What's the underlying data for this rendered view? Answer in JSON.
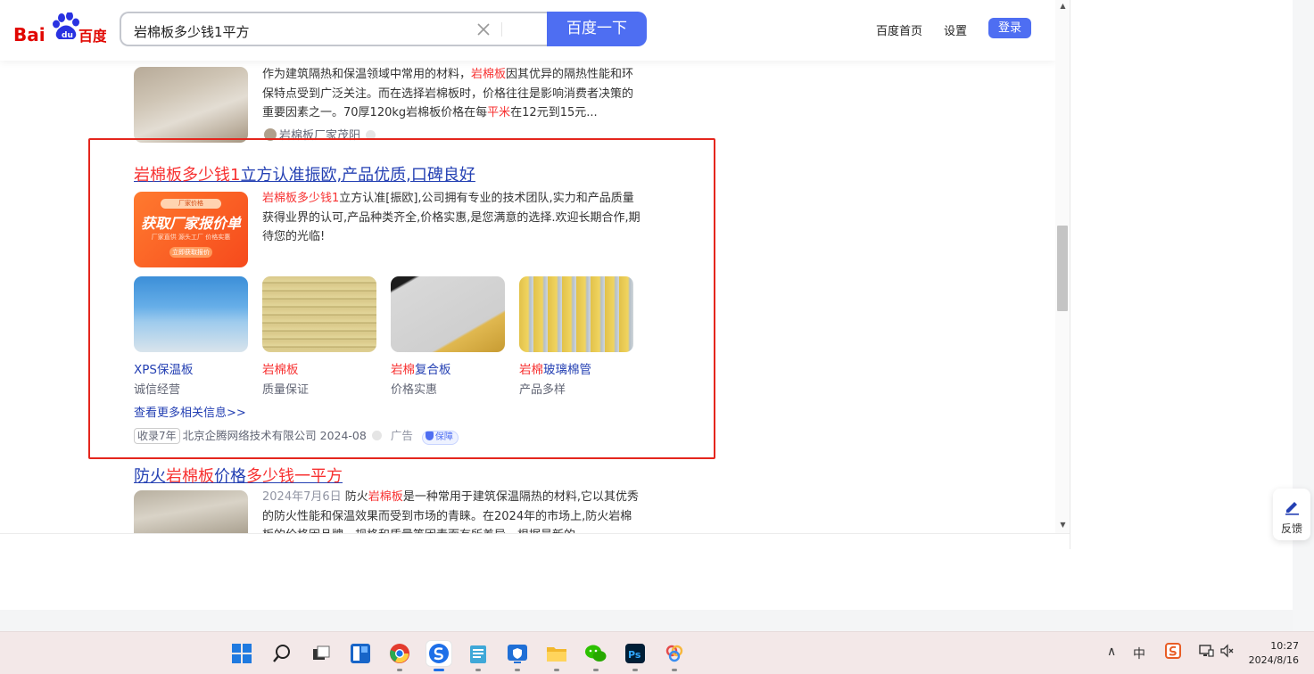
{
  "header": {
    "logo_left": "Bai",
    "logo_right": "百度",
    "search_query": "岩棉板多少钱1平方",
    "search_button": "百度一下",
    "nav": {
      "home": "百度首页",
      "settings": "设置",
      "login": "登录"
    }
  },
  "results": {
    "r1": {
      "snippet_a": "作为建筑隔热和保温领域中常用的材料，",
      "snippet_hl": "岩棉板",
      "snippet_b": "因其优异的隔热性能和环保特点受到广泛关注。而在选择岩棉板时，价格往往是影响消费者决策的重要因素之一。70厚120kg岩棉板价格在每",
      "snippet_hl2": "平米",
      "snippet_c": "在12元到15元...",
      "source": "岩棉板厂家茂阳"
    },
    "ad": {
      "title_hl": "岩棉板多少钱1",
      "title_rest": "立方认准振欧,产品优质,口碑良好",
      "banner_top": "厂家价格",
      "banner_main": "获取厂家报价单",
      "banner_sub": "厂家直供 源头工厂 价格实惠",
      "banner_btn": "立即获取报价",
      "snippet_hl": "岩棉板多少钱1",
      "snippet_rest": "立方认准[振欧],公司拥有专业的技术团队,实力和产品质量获得业界的认可,产品种类齐全,价格实惠,是您满意的选择.欢迎长期合作,期待您的光临!",
      "products": [
        {
          "name_hl": "",
          "name": "XPS保温板",
          "sub": "诚信经营"
        },
        {
          "name_hl": "岩棉板",
          "name": "",
          "sub": "质量保证"
        },
        {
          "name_hl": "岩棉",
          "name": "复合板",
          "sub": "价格实惠"
        },
        {
          "name_hl": "岩棉",
          "name": "玻璃棉管",
          "sub": "产品多样"
        }
      ],
      "more_link": "查看更多相关信息>>",
      "tag": "收录7年",
      "company": "北京企腾网络技术有限公司 2024-08",
      "ad_label": "广告",
      "guard": "保障"
    },
    "r3": {
      "title_a": "防火",
      "title_hl": "岩棉板",
      "title_b": "价格",
      "title_hl2": "多少钱一平方",
      "date": "2024年7月6日",
      "snippet_a": "防火",
      "snippet_hl": "岩棉板",
      "snippet_b": "是一种常用于建筑保温隔热的材料,它以其优秀的防火性能和保温效果而受到市场的青睐。在2024年的市场上,防火岩棉板的价格因品牌、规格和质量等因素而有所差异。根据最新的"
    }
  },
  "feedback": {
    "label": "反馈"
  },
  "taskbar": {
    "time": "10:27",
    "date": "2024/8/16",
    "ime": "中"
  },
  "colors": {
    "accent": "#4e6ef2",
    "link": "#2440b3",
    "highlight": "#f73131",
    "ad_frame": "#e4261d"
  }
}
